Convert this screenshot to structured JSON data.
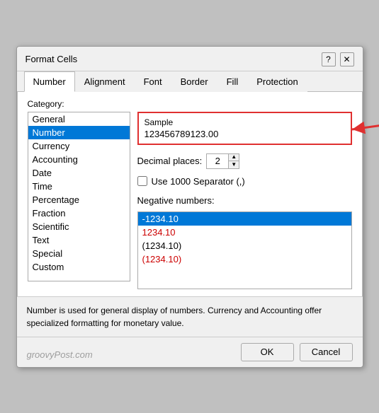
{
  "dialog": {
    "title": "Format Cells",
    "help_icon": "?",
    "close_icon": "✕"
  },
  "tabs": [
    {
      "label": "Number",
      "active": true
    },
    {
      "label": "Alignment",
      "active": false
    },
    {
      "label": "Font",
      "active": false
    },
    {
      "label": "Border",
      "active": false
    },
    {
      "label": "Fill",
      "active": false
    },
    {
      "label": "Protection",
      "active": false
    }
  ],
  "category": {
    "label": "Category:",
    "items": [
      "General",
      "Number",
      "Currency",
      "Accounting",
      "Date",
      "Time",
      "Percentage",
      "Fraction",
      "Scientific",
      "Text",
      "Special",
      "Custom"
    ],
    "selected": "Number"
  },
  "sample": {
    "label": "Sample",
    "value": "123456789123.00"
  },
  "decimal": {
    "label": "Decimal places:",
    "value": "2"
  },
  "separator": {
    "label": "Use 1000 Separator (,)"
  },
  "negative_numbers": {
    "label": "Negative numbers:",
    "items": [
      {
        "text": "-1234.10",
        "type": "selected"
      },
      {
        "text": "1234.10",
        "type": "red"
      },
      {
        "text": "(1234.10)",
        "type": "paren"
      },
      {
        "text": "(1234.10)",
        "type": "paren-red"
      }
    ]
  },
  "description": "Number is used for general display of numbers.  Currency and Accounting offer specialized formatting for monetary value.",
  "footer": {
    "ok_label": "OK",
    "cancel_label": "Cancel"
  },
  "watermark": "groovyPost.com"
}
